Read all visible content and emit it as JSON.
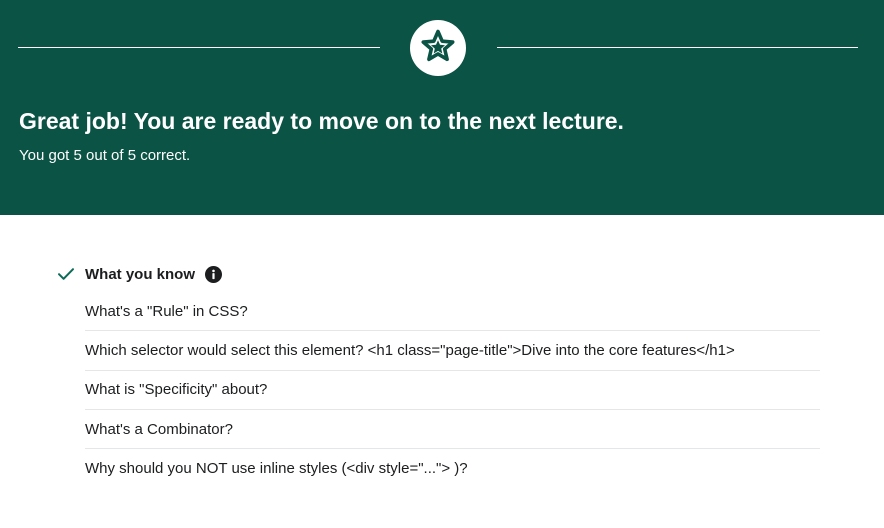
{
  "banner": {
    "title": "Great job! You are ready to move on to the next lecture.",
    "subtitle": "You got 5 out of 5 correct.",
    "icon": "star-icon",
    "background_color": "#0b5345"
  },
  "section": {
    "title": "What you know",
    "status_icon": "checkmark-icon",
    "info_icon": "info-icon",
    "questions": [
      "What's a \"Rule\" in CSS?",
      "Which selector would select this element? <h1 class=\"page-title\">Dive into the core features</h1>",
      "What is \"Specificity\" about?",
      "What's a Combinator?",
      "Why should you NOT use inline styles (<div style=\"...\"> )?"
    ]
  }
}
